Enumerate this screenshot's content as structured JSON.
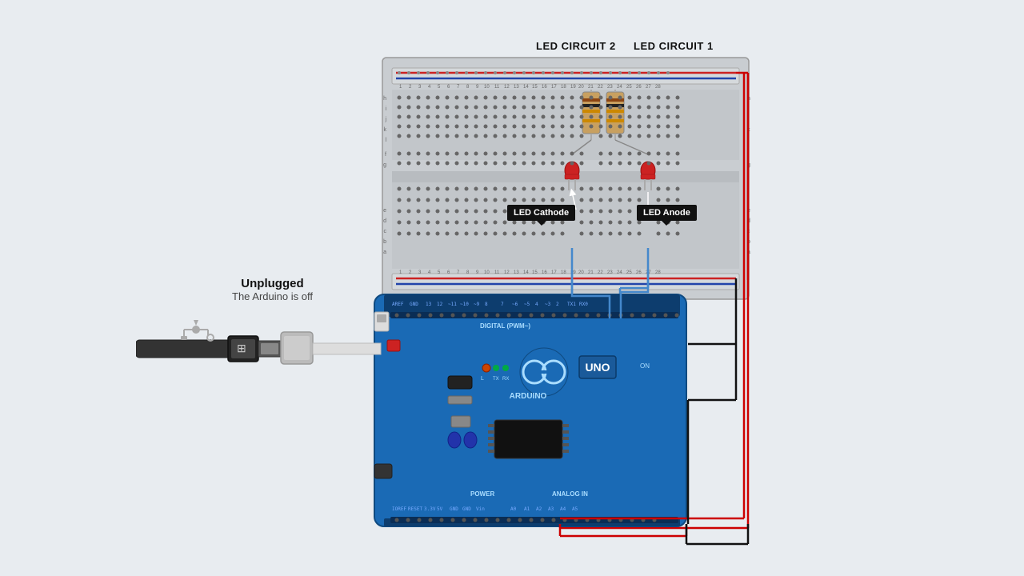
{
  "labels": {
    "circuit2": "LED CIRCUIT 2",
    "circuit1": "LED CIRCUIT 1",
    "cathode": "LED Cathode",
    "anode": "LED Anode",
    "unplugged_title": "Unplugged",
    "unplugged_sub": "The Arduino is off"
  },
  "colors": {
    "background": "#e8ecf0",
    "breadboard": "#c8ccd0",
    "arduino_blue": "#1a6ab5",
    "wire_red": "#cc0000",
    "wire_black": "#111111",
    "wire_blue": "#4488cc",
    "callout_bg": "#111111",
    "callout_text": "#ffffff"
  }
}
